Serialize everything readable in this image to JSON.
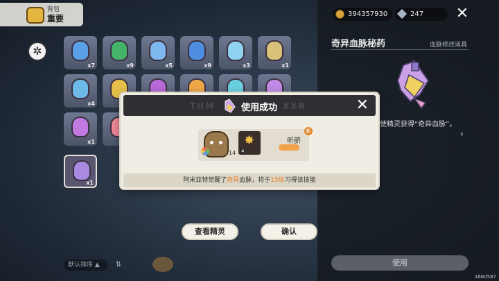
{
  "topbar": {
    "tab_small": "背包",
    "tab_main": "重要",
    "coins": "394357930",
    "gems": "247"
  },
  "inventory": {
    "slots": [
      {
        "count": "x7",
        "color": "#5aa0e6"
      },
      {
        "count": "x9",
        "color": "#45b46a"
      },
      {
        "count": "x5",
        "color": "#7fb8ee"
      },
      {
        "count": "x9",
        "color": "#4d8ee0"
      },
      {
        "count": "x3",
        "color": "#8fd3f0"
      },
      {
        "count": "x1",
        "color": "#d8c27a"
      },
      {
        "count": "x4",
        "color": "#6db9e8"
      },
      {
        "count": "",
        "color": "#e6c04a"
      },
      {
        "count": "",
        "color": "#b86ad8"
      },
      {
        "count": "",
        "color": "#f0a84a"
      },
      {
        "count": "",
        "color": "#6ad0e0"
      },
      {
        "count": "",
        "color": "#c08ae6"
      },
      {
        "count": "x1",
        "color": "#c07ae0"
      },
      {
        "count": "",
        "color": "#f08a9a"
      },
      {
        "count": "x1",
        "color": "#a88ae0"
      }
    ],
    "sort_label": "默认排序"
  },
  "detail": {
    "title": "奇异血脉秘药",
    "tag": "血脉修改道具",
    "desc": "使精灵获得“奇异血脉”。",
    "use_button": "使用"
  },
  "dialog": {
    "title": "使用成功",
    "deco_left": "THM",
    "deco_right": "XXR",
    "pet_level": "14",
    "skill_level": "4",
    "skill_name": "听脐",
    "new_badge": "新",
    "msg_pre": "阿米亚特觉醒了",
    "msg_hl1": "奇异",
    "msg_mid": "血脉，将于",
    "msg_hl2": "15级",
    "msg_post": "习得该技能"
  },
  "buttons": {
    "view_pet": "查看精灵",
    "confirm": "确认"
  },
  "uid": "1660587"
}
